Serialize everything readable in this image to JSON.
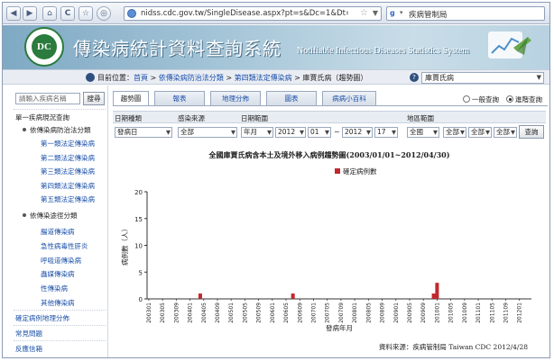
{
  "browser": {
    "url": "nidss.cdc.gov.tw/SingleDisease.aspx?pt=s&Dc=1&Dt=4&",
    "search_text": "疾病管制局",
    "search_engine": "g"
  },
  "banner": {
    "title_zh": "傳染病統計資料查詢系統",
    "title_en": "Notifiable Infectious Diseases Statistics System",
    "logo_text": "DC"
  },
  "location": {
    "prefix": "目前位置：",
    "crumbs": [
      "首頁",
      "依傳染病防治法分類",
      "第四類法定傳染病"
    ],
    "current": "庫賈氏病（趨勢圖）",
    "separator": " > ",
    "disease_select": "庫賈氏病"
  },
  "sidebar": {
    "search_placeholder": "請輸入疾病名稱",
    "search_button": "搜尋",
    "section_title": "單一疾病現況查詢",
    "group1": "依傳染病防治法分類",
    "group1_items": [
      "第一類法定傳染病",
      "第二類法定傳染病",
      "第三類法定傳染病",
      "第四類法定傳染病",
      "第五類法定傳染病"
    ],
    "group2": "依傳染途徑分類",
    "group2_items": [
      "腸道傳染病",
      "急性病毒性肝炎",
      "呼吸道傳染病",
      "蟲媒傳染病",
      "性傳染病",
      "其他傳染病"
    ],
    "root_items": [
      "確定病例地理分佈",
      "常見問題",
      "反應信箱"
    ]
  },
  "tabs": [
    "趨勢圖",
    "報表",
    "地理分佈",
    "圖表",
    "病病小百科"
  ],
  "query_mode": {
    "general": "一般查詢",
    "advanced": "進階查詢",
    "selected": "advanced"
  },
  "filters": {
    "headers": {
      "date_type": "日期種類",
      "source": "感染來源",
      "date_range": "日期範圍",
      "region": "地區範圍"
    },
    "date_type": "發病日",
    "source": "全部",
    "range_unit": "年月",
    "start_year": "2012",
    "start_month": "01",
    "tilde": "~",
    "end_year": "2012",
    "end_month": "17",
    "region1": "全國",
    "region2": "全部",
    "region3": "全部",
    "region4": "全部",
    "query_button": "查詢"
  },
  "chart_data": {
    "type": "bar",
    "title": "全國庫賈氏病含本土及境外移入病例趨勢圖(2003/01/01~2012/04/30)",
    "legend": "確定病例數",
    "ylabel": "病例數（人）",
    "xlabel": "發病年月",
    "ylim": [
      0,
      20
    ],
    "yticks": [
      0,
      5,
      10,
      15,
      20
    ],
    "color": "#c0282d",
    "tick_labels": [
      "200301",
      "200305",
      "200309",
      "200401",
      "200405",
      "200409",
      "200501",
      "200505",
      "200509",
      "200601",
      "200605",
      "200609",
      "200701",
      "200705",
      "200709",
      "200801",
      "200805",
      "200809",
      "200901",
      "200905",
      "200909",
      "201001",
      "201005",
      "201009",
      "201101",
      "201105",
      "201109",
      "201201"
    ],
    "months": [
      "200301",
      "200302",
      "200303",
      "200304",
      "200305",
      "200306",
      "200307",
      "200308",
      "200309",
      "200310",
      "200311",
      "200312",
      "200401",
      "200402",
      "200403",
      "200404",
      "200405",
      "200406",
      "200407",
      "200408",
      "200409",
      "200410",
      "200411",
      "200412",
      "200501",
      "200502",
      "200503",
      "200504",
      "200505",
      "200506",
      "200507",
      "200508",
      "200509",
      "200510",
      "200511",
      "200512",
      "200601",
      "200602",
      "200603",
      "200604",
      "200605",
      "200606",
      "200607",
      "200608",
      "200609",
      "200610",
      "200611",
      "200612",
      "200701",
      "200702",
      "200703",
      "200704",
      "200705",
      "200706",
      "200707",
      "200708",
      "200709",
      "200710",
      "200711",
      "200712",
      "200801",
      "200802",
      "200803",
      "200804",
      "200805",
      "200806",
      "200807",
      "200808",
      "200809",
      "200810",
      "200811",
      "200812",
      "200901",
      "200902",
      "200903",
      "200904",
      "200905",
      "200906",
      "200907",
      "200908",
      "200909",
      "200910",
      "200911",
      "200912",
      "201001",
      "201002",
      "201003",
      "201004",
      "201005",
      "201006",
      "201007",
      "201008",
      "201009",
      "201010",
      "201011",
      "201012",
      "201101",
      "201102",
      "201103",
      "201104",
      "201105",
      "201106",
      "201107",
      "201108",
      "201109",
      "201110",
      "201111",
      "201112",
      "201201",
      "201202",
      "201203",
      "201204"
    ],
    "nonzero": {
      "200404": 1,
      "200607": 1,
      "200912": 1,
      "201001": 3
    }
  },
  "source_note": "資料來源：疾病管制局 Taiwan CDC 2012/4/28"
}
